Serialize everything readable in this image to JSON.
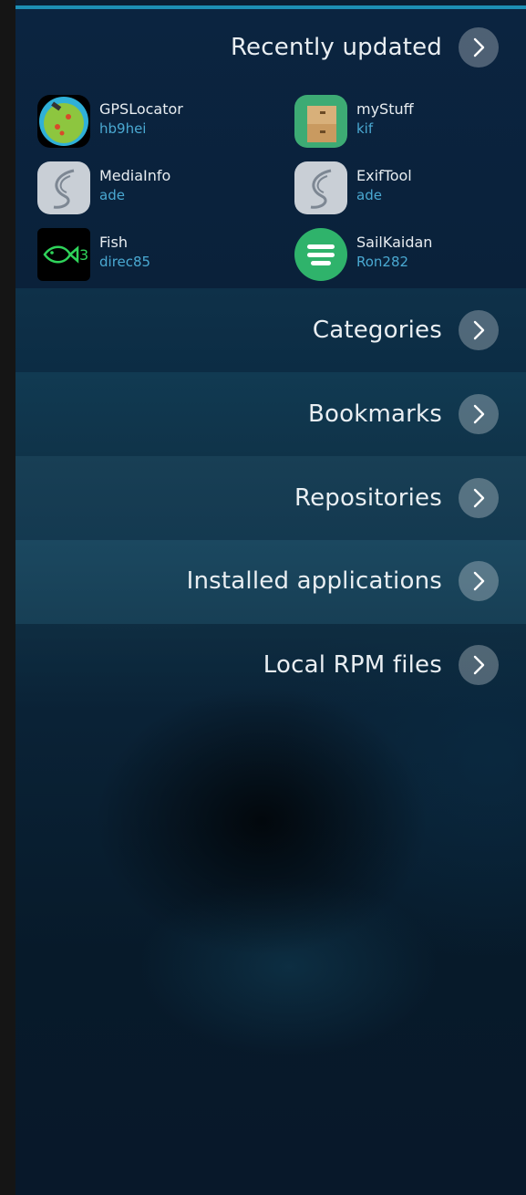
{
  "recent": {
    "title": "Recently updated",
    "apps": [
      {
        "name": "GPSLocator",
        "author": "hb9hei",
        "icon": "gps-locator-icon"
      },
      {
        "name": "myStuff",
        "author": "kif",
        "icon": "boxes-icon"
      },
      {
        "name": "MediaInfo",
        "author": "ade",
        "icon": "sailfish-leaf-icon"
      },
      {
        "name": "ExifTool",
        "author": "ade",
        "icon": "sailfish-leaf-icon"
      },
      {
        "name": "Fish",
        "author": "direc85",
        "icon": "fish-icon"
      },
      {
        "name": "SailKaidan",
        "author": "Ron282",
        "icon": "chat-lines-icon"
      }
    ]
  },
  "menu": [
    {
      "label": "Categories"
    },
    {
      "label": "Bookmarks"
    },
    {
      "label": "Repositories"
    },
    {
      "label": "Installed applications"
    },
    {
      "label": "Local RPM files"
    }
  ],
  "colors": {
    "accent": "#1d8fb5",
    "author": "#4aa9d2",
    "text": "#e9eef2"
  }
}
